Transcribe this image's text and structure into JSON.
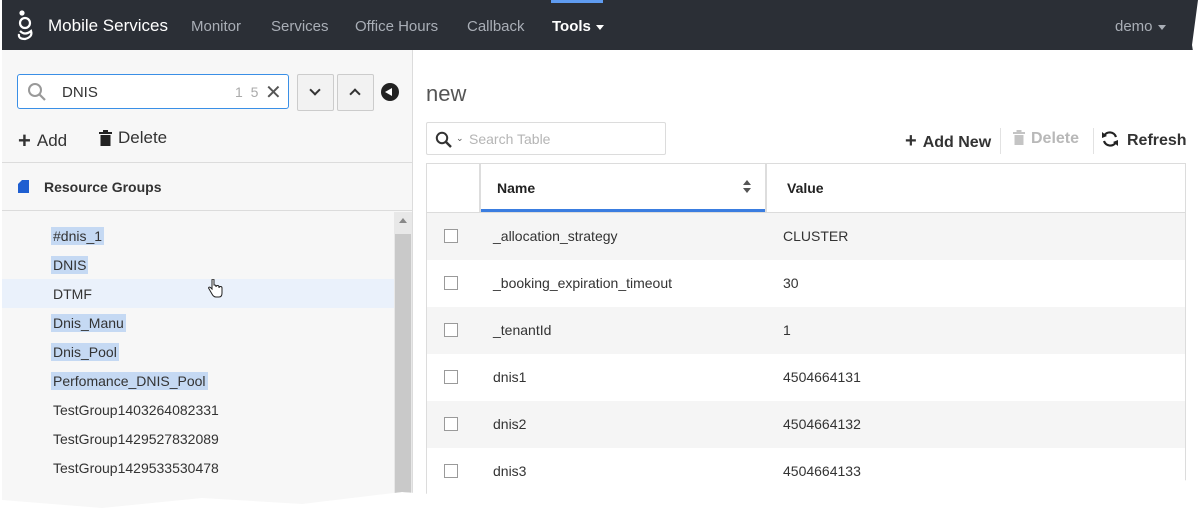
{
  "app": {
    "brand": "Mobile Services",
    "nav": [
      {
        "label": "Monitor",
        "active": false
      },
      {
        "label": "Services",
        "active": false
      },
      {
        "label": "Office Hours",
        "active": false
      },
      {
        "label": "Callback",
        "active": false
      },
      {
        "label": "Tools",
        "active": true,
        "dropdown": true
      }
    ],
    "user": "demo",
    "accent_color": "#5f9cf1",
    "topbar_color": "#2b2f36"
  },
  "left_panel": {
    "search": {
      "value": "DNIS",
      "count": "1 5",
      "icon": "search-icon"
    },
    "actions": {
      "add": "Add",
      "delete": "Delete"
    },
    "section_title": "Resource Groups",
    "items": [
      {
        "label": "#dnis_1",
        "highlighted": true
      },
      {
        "label": "DNIS",
        "highlighted": true
      },
      {
        "label": "DTMF",
        "highlighted": false,
        "hovered": true
      },
      {
        "label": "Dnis_Manu",
        "highlighted": true
      },
      {
        "label": "Dnis_Pool",
        "highlighted": true
      },
      {
        "label": "Perfomance_DNIS_Pool",
        "highlighted": true
      },
      {
        "label": "TestGroup1403264082331",
        "highlighted": false
      },
      {
        "label": "TestGroup1429527832089",
        "highlighted": false
      },
      {
        "label": "TestGroup1429533530478",
        "highlighted": false
      }
    ]
  },
  "main": {
    "title": "new",
    "search_placeholder": "Search Table",
    "toolbar": {
      "add_new": "Add New",
      "delete": "Delete",
      "refresh": "Refresh"
    },
    "table": {
      "columns": [
        "Name",
        "Value"
      ],
      "rows": [
        {
          "name": "_allocation_strategy",
          "value": "CLUSTER"
        },
        {
          "name": "_booking_expiration_timeout",
          "value": "30"
        },
        {
          "name": "_tenantId",
          "value": "1"
        },
        {
          "name": "dnis1",
          "value": "4504664131"
        },
        {
          "name": "dnis2",
          "value": "4504664132"
        },
        {
          "name": "dnis3",
          "value": "4504664133"
        }
      ]
    }
  }
}
